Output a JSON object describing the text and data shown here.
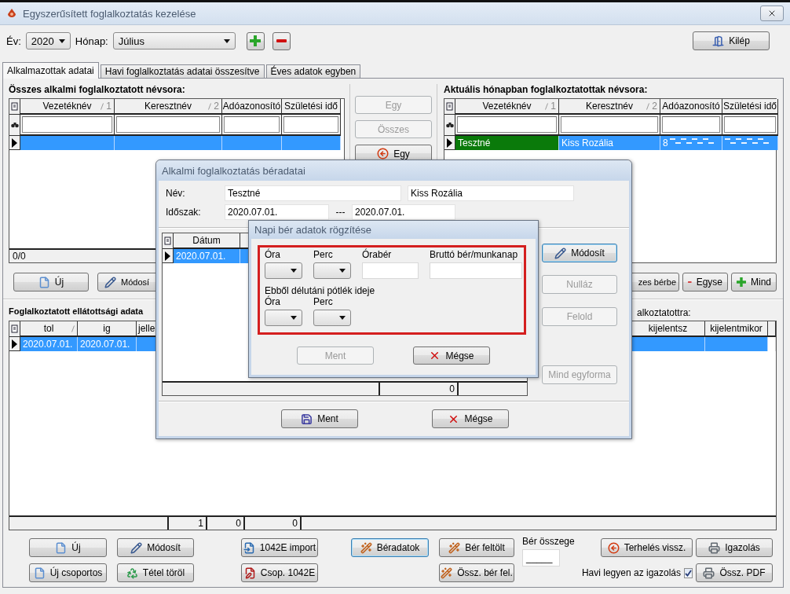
{
  "window": {
    "title": "Egyszerűsített foglalkoztatás kezelése"
  },
  "toolbar": {
    "year_label": "Év:",
    "year": "2020",
    "month_label": "Hónap:",
    "month": "Július",
    "exit_button": "Kilép"
  },
  "tabs": [
    {
      "label": "Alkalmazottak adatai",
      "selected": true
    },
    {
      "label": "Havi foglalkoztatás adatai összesítve",
      "selected": false
    },
    {
      "label": "Éves adatok egyben",
      "selected": false
    }
  ],
  "all_employees": {
    "title": "Összes alkalmi foglalkoztatott névsora:",
    "columns": [
      {
        "label": "Vezetéknév",
        "sort": "1"
      },
      {
        "label": "Keresztnév",
        "sort": "2"
      },
      {
        "label": "Adóazonosító"
      },
      {
        "label": "Születési idő"
      }
    ],
    "rows": [
      {
        "cells": [
          "",
          "",
          "",
          ""
        ],
        "selected": true
      }
    ],
    "footer": "0/0"
  },
  "transfer_buttons": [
    {
      "label": "Egy",
      "disabled": true
    },
    {
      "label": "Összes",
      "disabled": true
    },
    {
      "label": "Egy",
      "disabled": false
    }
  ],
  "monthly_employees": {
    "title": "Aktuális hónapban foglalkoztatottak névsora:",
    "columns": [
      {
        "label": "Vezetéknév",
        "sort": "1"
      },
      {
        "label": "Keresztnév",
        "sort": "2"
      },
      {
        "label": "Adóazonosító"
      },
      {
        "label": "Születési idő"
      }
    ],
    "rows": [
      {
        "cells": [
          {
            "text": "Tesztné",
            "current": true
          },
          {
            "text": "Kiss Rozália"
          },
          {
            "text": "8",
            "redacted": true
          },
          {
            "redacted": true
          }
        ],
        "selected": true
      }
    ]
  },
  "upper_buttons_left": [
    "Új",
    "Módosí"
  ],
  "upper_buttons_right": [
    "zes bérbe",
    "Egyse",
    "Mind"
  ],
  "coverage": {
    "title": "Foglalkoztatott ellátottsági adata",
    "title_right": "alkoztatottra:",
    "columns": [
      {
        "label": "tol",
        "sorted": true
      },
      {
        "label": "ig",
        "sorted": false
      },
      {
        "label": "jelle",
        "sorted": false
      },
      {
        "label": "kijelentsz",
        "sorted": false
      },
      {
        "label": "kijelentmikor",
        "sorted": false
      }
    ],
    "rows": [
      {
        "cells": [
          "2020.07.01.",
          "2020.07.01.",
          "",
          "",
          ""
        ],
        "selected": true
      }
    ],
    "footer": [
      "1",
      "0",
      "0"
    ]
  },
  "bottom_buttons": [
    [
      {
        "label": "Új",
        "focused": false
      },
      {
        "label": "Új csoportos",
        "focused": false
      }
    ],
    [
      {
        "label": "Módosít",
        "focused": false
      },
      {
        "label": "Tétel töröl",
        "focused": false
      }
    ],
    [
      {
        "label": "1042E import",
        "focused": false
      },
      {
        "label": "Csop. 1042E",
        "focused": false
      }
    ],
    [
      {
        "label": "Béradatok",
        "focused": true
      }
    ],
    [
      {
        "label": "Bér feltölt",
        "focused": false
      },
      {
        "label": "Össz. bér fel.",
        "focused": false
      }
    ]
  ],
  "wage_total": {
    "label": "Bér összege",
    "value": "_____"
  },
  "return_button": "Terhelés vissz.",
  "monthly_certificate": {
    "label": "Havi legyen az igazolás",
    "checked": true
  },
  "print_buttons": [
    "Igazolás",
    "Össz. PDF"
  ],
  "wage_data_dialog": {
    "title": "Alkalmi foglalkoztatás béradatai",
    "name_label": "Név:",
    "last_name": "Tesztné",
    "first_name": "Kiss Rozália",
    "period_label": "Időszak:",
    "period_from": "2020.07.01.",
    "period_separator": "---",
    "period_to": "2020.07.01.",
    "columns": [
      "Dátum"
    ],
    "rows": [
      {
        "cells": [
          "2020.07.01."
        ],
        "selected": true
      }
    ],
    "footer": "0",
    "side_buttons": [
      {
        "label": "Módosít",
        "disabled": false,
        "focused": true
      },
      {
        "label": "Nulláz",
        "disabled": true,
        "focused": false
      },
      {
        "label": "Felold",
        "disabled": true,
        "focused": false
      },
      {
        "label": "Mind egyforma",
        "disabled": true,
        "focused": false
      }
    ],
    "buttons": [
      {
        "label": "Ment",
        "disabled": false
      },
      {
        "label": "Mégse",
        "disabled": false
      }
    ]
  },
  "daily_wage_dialog": {
    "title": "Napi bér adatok rögzítése",
    "highlighted": true,
    "fields": [
      {
        "label": "Óra",
        "kind": "select"
      },
      {
        "label": "Perc",
        "kind": "select"
      },
      {
        "label": "Órabér",
        "kind": "input"
      },
      {
        "label": "Bruttó bér/munkanap",
        "kind": "input"
      }
    ],
    "subtitle": "Ebből délutáni pótlék ideje",
    "sub_fields": [
      {
        "label": "Óra",
        "kind": "select"
      },
      {
        "label": "Perc",
        "kind": "select"
      }
    ],
    "buttons": [
      {
        "label": "Ment",
        "disabled": true
      },
      {
        "label": "Mégse",
        "disabled": false
      }
    ]
  }
}
